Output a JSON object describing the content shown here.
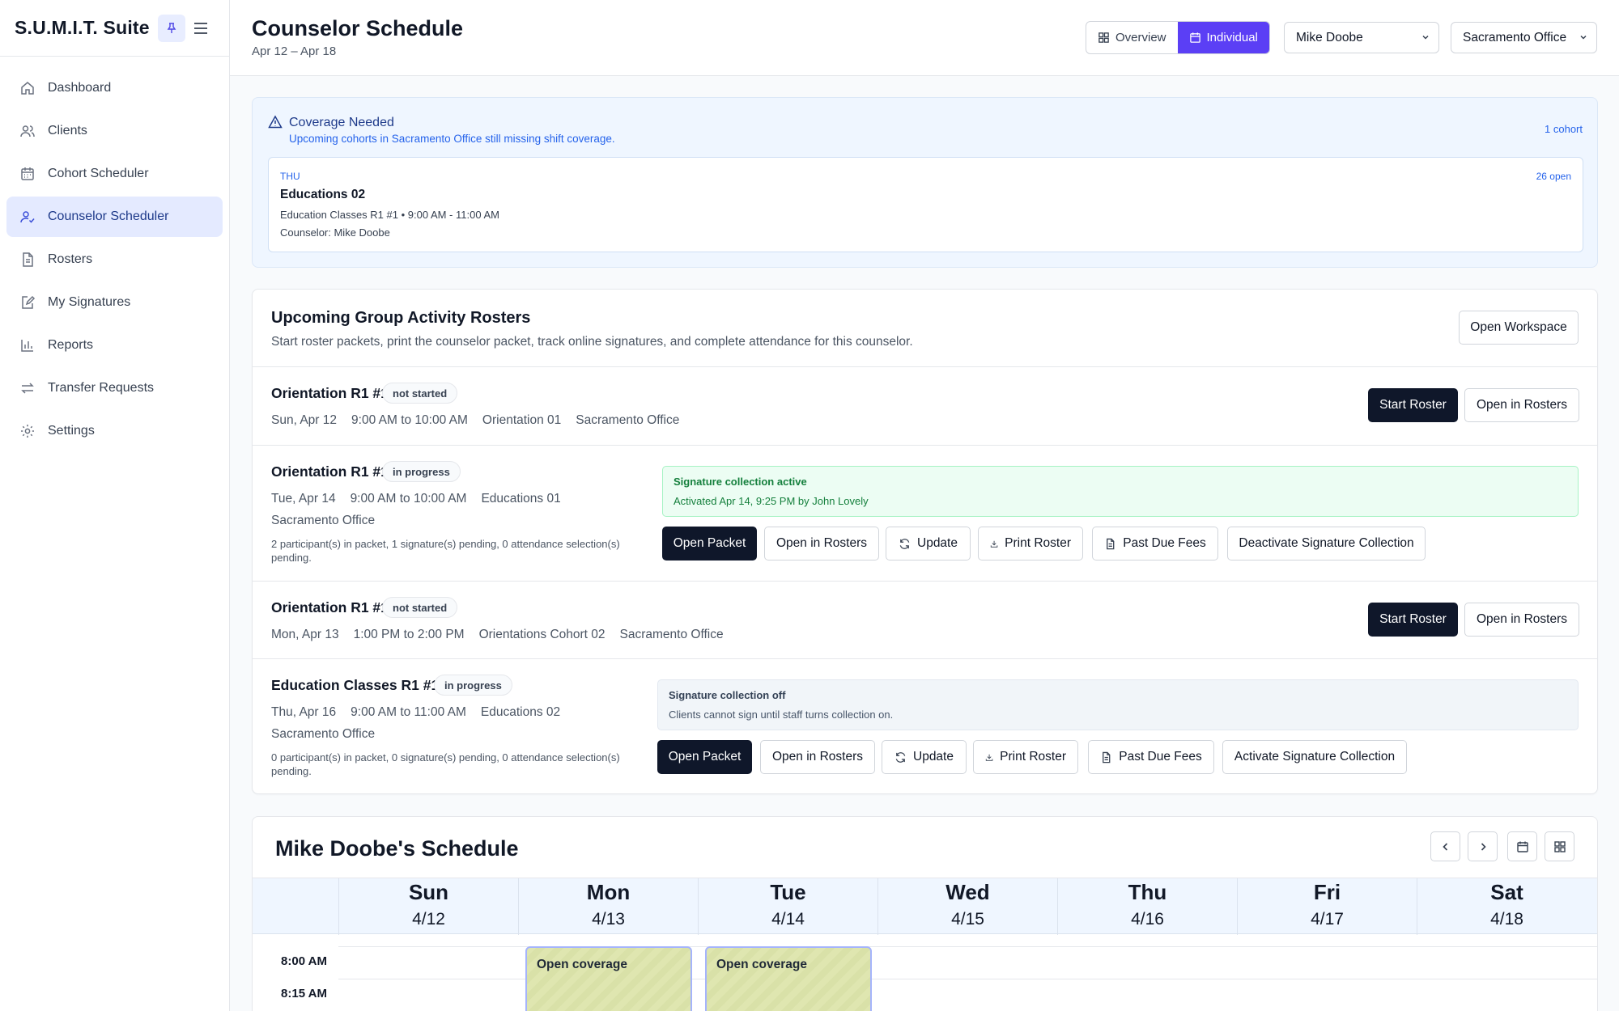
{
  "app": {
    "name": "S.U.M.I.T. Suite"
  },
  "nav": [
    {
      "label": "Dashboard",
      "icon": "home-icon"
    },
    {
      "label": "Clients",
      "icon": "users-icon"
    },
    {
      "label": "Cohort Scheduler",
      "icon": "calendar-icon"
    },
    {
      "label": "Counselor Scheduler",
      "icon": "user-check-icon",
      "active": true
    },
    {
      "label": "Rosters",
      "icon": "document-icon"
    },
    {
      "label": "My Signatures",
      "icon": "signature-icon"
    },
    {
      "label": "Reports",
      "icon": "bar-chart-icon"
    },
    {
      "label": "Transfer Requests",
      "icon": "transfer-icon"
    },
    {
      "label": "Settings",
      "icon": "gear-icon"
    }
  ],
  "header": {
    "title": "Counselor Schedule",
    "date_range": "Apr 12 – Apr 18",
    "view_overview": "Overview",
    "view_individual": "Individual",
    "counselor_select": "Mike Doobe",
    "office_select": "Sacramento Office"
  },
  "coverage": {
    "title": "Coverage Needed",
    "subtitle": "Upcoming cohorts in Sacramento Office still missing shift coverage.",
    "count": "1 cohort",
    "card": {
      "day": "THU",
      "open": "26 open",
      "name": "Educations 02",
      "detail": "Education Classes R1 #1 • 9:00 AM - 11:00 AM",
      "counselor": "Counselor: Mike Doobe"
    }
  },
  "rosters": {
    "title": "Upcoming Group Activity Rosters",
    "subtitle": "Start roster packets, print the counselor packet, track online signatures, and complete attendance for this counselor.",
    "open_workspace": "Open Workspace",
    "rows": [
      {
        "name": "Orientation R1 #1",
        "status": "not started",
        "date": "Sun, Apr 12",
        "time": "9:00 AM to 10:00 AM",
        "cohort": "Orientation 01",
        "office": "Sacramento Office",
        "start": "Start Roster",
        "open_rosters": "Open in Rosters"
      },
      {
        "name": "Orientation R1 #1",
        "status": "in progress",
        "date": "Tue, Apr 14",
        "time": "9:00 AM to 10:00 AM",
        "cohort": "Educations 01",
        "office": "Sacramento Office",
        "note": "2 participant(s) in packet, 1 signature(s) pending, 0 attendance selection(s) pending.",
        "sig_title": "Signature collection active",
        "sig_detail": "Activated Apr 14, 9:25 PM by John Lovely",
        "open_packet": "Open Packet",
        "open_rosters": "Open in Rosters",
        "update": "Update",
        "print": "Print Roster",
        "fees": "Past Due Fees",
        "toggle": "Deactivate Signature Collection"
      },
      {
        "name": "Orientation R1 #1",
        "status": "not started",
        "date": "Mon, Apr 13",
        "time": "1:00 PM to 2:00 PM",
        "cohort": "Orientations Cohort 02",
        "office": "Sacramento Office",
        "start": "Start Roster",
        "open_rosters": "Open in Rosters"
      },
      {
        "name": "Education Classes R1 #1",
        "status": "in progress",
        "date": "Thu, Apr 16",
        "time": "9:00 AM to 11:00 AM",
        "cohort": "Educations 02",
        "office": "Sacramento Office",
        "note": "0 participant(s) in packet, 0 signature(s) pending, 0 attendance selection(s) pending.",
        "sig_title": "Signature collection off",
        "sig_detail": "Clients cannot sign until staff turns collection on.",
        "open_packet": "Open Packet",
        "open_rosters": "Open in Rosters",
        "update": "Update",
        "print": "Print Roster",
        "fees": "Past Due Fees",
        "toggle": "Activate Signature Collection"
      }
    ]
  },
  "schedule": {
    "title": "Mike Doobe's Schedule",
    "days": [
      {
        "name": "Sun",
        "date": "4/12"
      },
      {
        "name": "Mon",
        "date": "4/13"
      },
      {
        "name": "Tue",
        "date": "4/14"
      },
      {
        "name": "Wed",
        "date": "4/15"
      },
      {
        "name": "Thu",
        "date": "4/16"
      },
      {
        "name": "Fri",
        "date": "4/17"
      },
      {
        "name": "Sat",
        "date": "4/18"
      }
    ],
    "times": [
      "8:00 AM",
      "8:15 AM"
    ],
    "events": [
      {
        "day": "Mon",
        "label": "Open coverage"
      },
      {
        "day": "Tue",
        "label": "Open coverage"
      }
    ]
  },
  "colors": {
    "accent": "#5b3ff5",
    "dark_button": "#0f172a",
    "active_nav": "#e4eaff",
    "coverage_bg": "#eff6ff"
  }
}
